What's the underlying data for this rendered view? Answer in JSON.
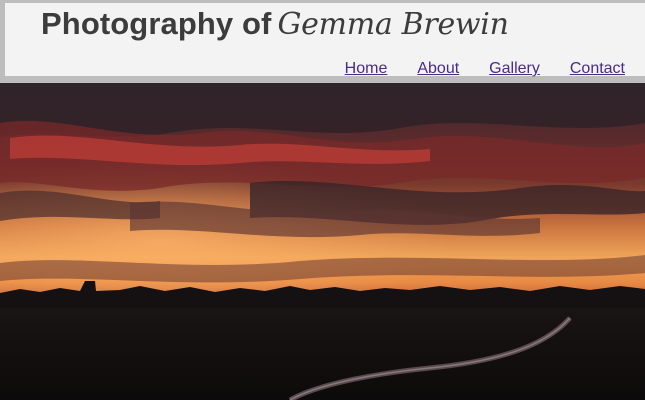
{
  "site": {
    "title_prefix": "Photography of",
    "title_name": "Gemma Brewin"
  },
  "nav": {
    "items": [
      {
        "label": "Home"
      },
      {
        "label": "About"
      },
      {
        "label": "Gallery"
      },
      {
        "label": "Contact"
      }
    ]
  },
  "colors": {
    "header_bg": "#f3f3f3",
    "header_border": "#bdbdbd",
    "link": "#4a2a8a",
    "title": "#3c3c3c"
  }
}
